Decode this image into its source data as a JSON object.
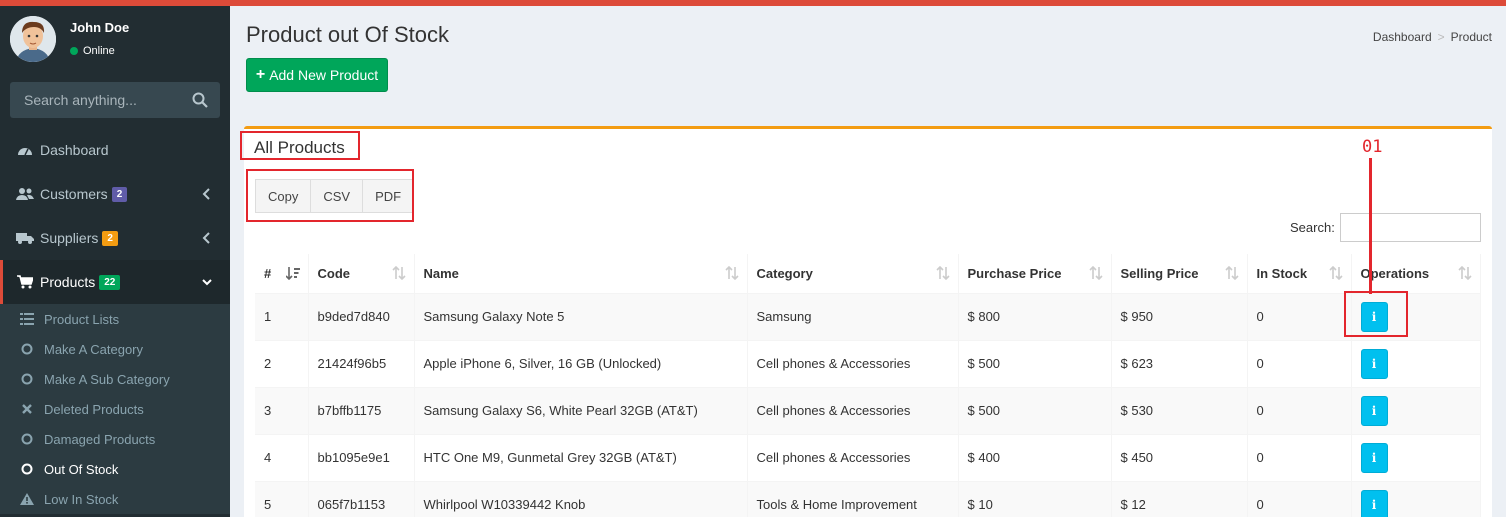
{
  "user": {
    "name": "John Doe",
    "status": "Online"
  },
  "sidebar_search": {
    "placeholder": "Search anything..."
  },
  "menu": {
    "dashboard": "Dashboard",
    "customers": {
      "label": "Customers",
      "badge": "2",
      "badge_color": "#605ca8"
    },
    "suppliers": {
      "label": "Suppliers",
      "badge": "2",
      "badge_color": "#f39c12"
    },
    "products": {
      "label": "Products",
      "badge": "22",
      "badge_color": "#00a65a"
    },
    "submenu": [
      {
        "label": "Product Lists",
        "icon": "list-icon"
      },
      {
        "label": "Make A Category",
        "icon": "circle-icon"
      },
      {
        "label": "Make A Sub Category",
        "icon": "circle-icon"
      },
      {
        "label": "Deleted Products",
        "icon": "times-icon"
      },
      {
        "label": "Damaged Products",
        "icon": "circle-icon"
      },
      {
        "label": "Out Of Stock",
        "icon": "circle-icon"
      },
      {
        "label": "Low In Stock",
        "icon": "warning-icon"
      }
    ]
  },
  "page": {
    "title": "Product out Of Stock",
    "breadcrumb": [
      "Dashboard",
      "Product"
    ],
    "add_button": "Add New Product",
    "box_title": "All Products",
    "export": [
      "Copy",
      "CSV",
      "PDF"
    ],
    "search_label": "Search:",
    "annotation": "01"
  },
  "table": {
    "columns": [
      "#",
      "Code",
      "Name",
      "Category",
      "Purchase Price",
      "Selling Price",
      "In Stock",
      "Operations"
    ],
    "rows": [
      [
        "1",
        "b9ded7d840",
        "Samsung Galaxy Note 5",
        "Samsung",
        "$ 800",
        "$ 950",
        "0"
      ],
      [
        "2",
        "21424f96b5",
        "Apple iPhone 6, Silver, 16 GB (Unlocked)",
        "Cell phones & Accessories",
        "$ 500",
        "$ 623",
        "0"
      ],
      [
        "3",
        "b7bffb1175",
        "Samsung Galaxy S6, White Pearl 32GB (AT&T)",
        "Cell phones & Accessories",
        "$ 500",
        "$ 530",
        "0"
      ],
      [
        "4",
        "bb1095e9e1",
        "HTC One M9, Gunmetal Grey 32GB (AT&T)",
        "Cell phones & Accessories",
        "$ 400",
        "$ 450",
        "0"
      ],
      [
        "5",
        "065f7b1153",
        "Whirlpool W10339442 Knob",
        "Tools & Home Improvement",
        "$ 10",
        "$ 12",
        "0"
      ]
    ]
  },
  "colors": {
    "header_bar": "#dd4b39",
    "sidebar": "#222d32",
    "accent_box": "#f39c12",
    "info_button": "#00c0ef",
    "annotation": "#e3262d"
  }
}
